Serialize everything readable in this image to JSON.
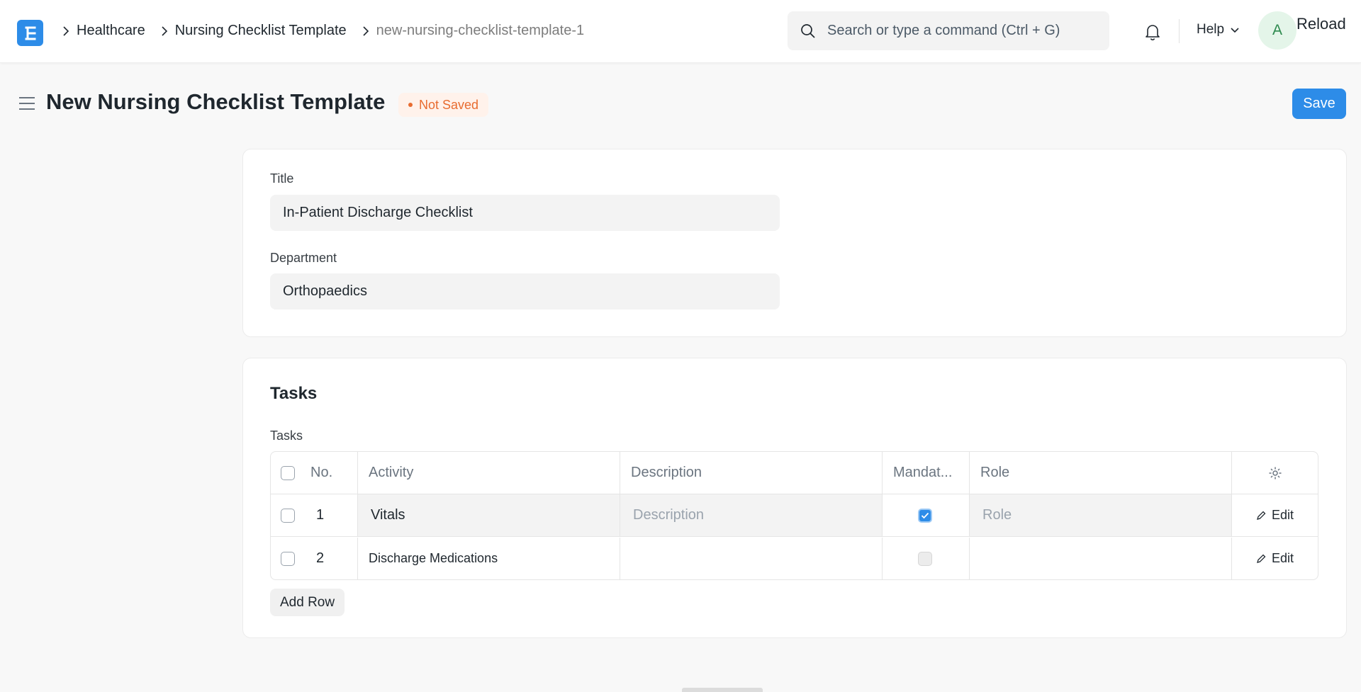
{
  "breadcrumbs": [
    {
      "label": "Healthcare"
    },
    {
      "label": "Nursing Checklist Template"
    },
    {
      "label": "new-nursing-checklist-template-1"
    }
  ],
  "search": {
    "placeholder": "Search or type a command (Ctrl + G)"
  },
  "navbar": {
    "help_label": "Help",
    "avatar_initial": "A",
    "reload_label": "Reload"
  },
  "page": {
    "title": "New Nursing Checklist Template",
    "status": "Not Saved",
    "save_label": "Save"
  },
  "form": {
    "title_label": "Title",
    "title_value": "In-Patient Discharge Checklist",
    "department_label": "Department",
    "department_value": "Orthopaedics"
  },
  "tasks": {
    "section_title": "Tasks",
    "grid_label": "Tasks",
    "columns": {
      "no": "No.",
      "activity": "Activity",
      "description": "Description",
      "mandatory": "Mandat...",
      "role": "Role"
    },
    "rows": [
      {
        "no": "1",
        "activity": "Vitals",
        "description_placeholder": "Description",
        "mandatory": true,
        "role_placeholder": "Role",
        "edit_label": "Edit"
      },
      {
        "no": "2",
        "activity": "Discharge Medications",
        "description": "",
        "mandatory": false,
        "role": "",
        "edit_label": "Edit"
      }
    ],
    "add_row_label": "Add Row"
  },
  "colors": {
    "accent": "#2d8ce8",
    "warning": "#e86c30"
  }
}
